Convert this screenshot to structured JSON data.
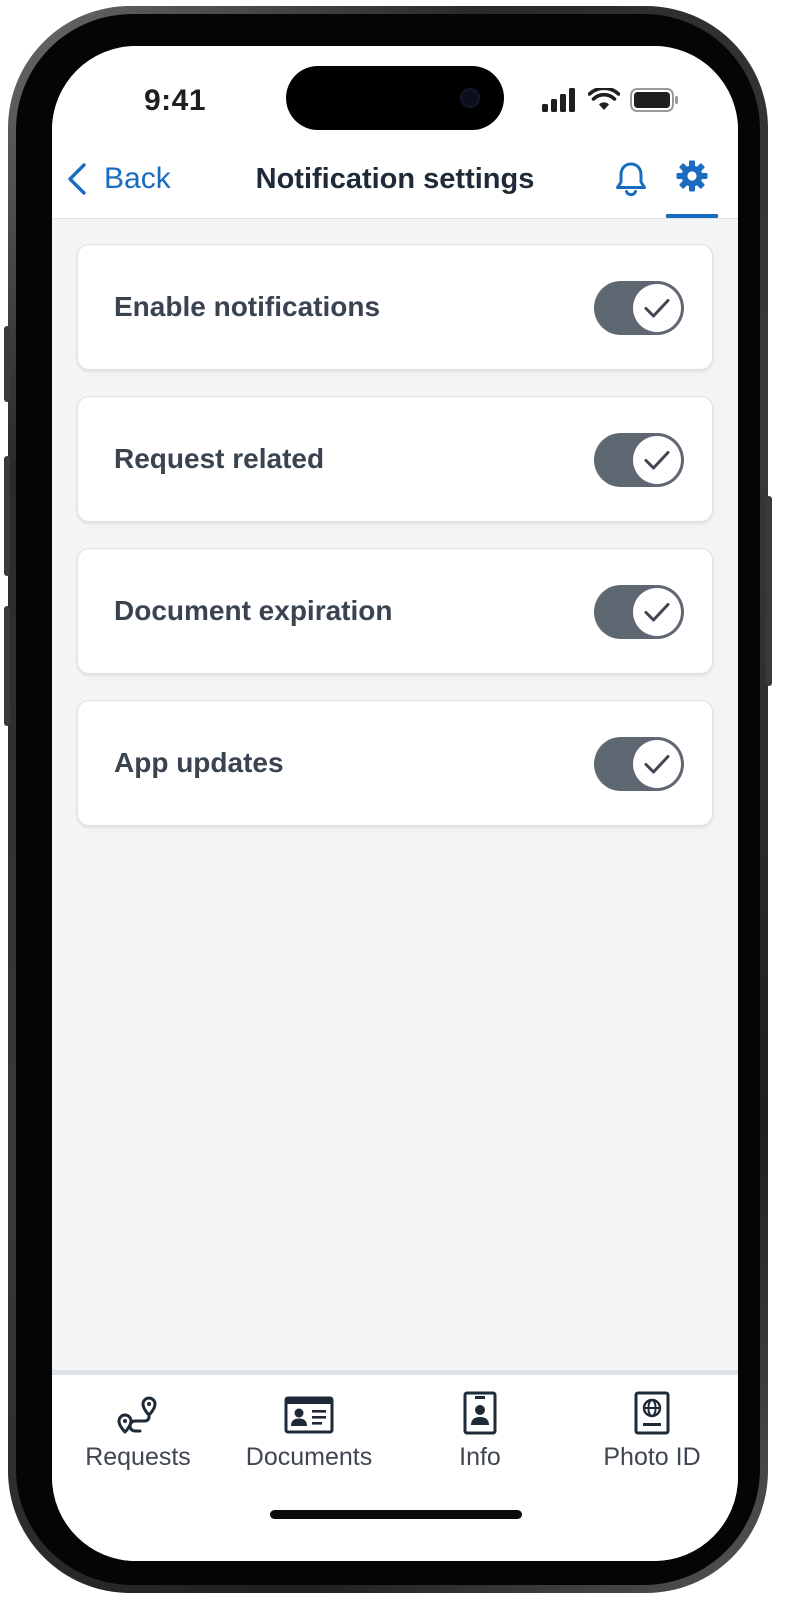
{
  "status_bar": {
    "time": "9:41"
  },
  "header": {
    "back_label": "Back",
    "title": "Notification settings",
    "active_tab_color": "#1a6cc0"
  },
  "settings": [
    {
      "label": "Enable notifications",
      "enabled": true
    },
    {
      "label": "Request related",
      "enabled": true
    },
    {
      "label": "Document expiration",
      "enabled": true
    },
    {
      "label": "App updates",
      "enabled": true
    }
  ],
  "tab_bar": {
    "tabs": [
      {
        "label": "Requests",
        "icon": "route-icon"
      },
      {
        "label": "Documents",
        "icon": "id-card-icon"
      },
      {
        "label": "Info",
        "icon": "badge-icon"
      },
      {
        "label": "Photo ID",
        "icon": "passport-icon"
      }
    ]
  },
  "colors": {
    "accent": "#1a6cc0",
    "toggle_on": "#5f6773",
    "background": "#f3f4f6"
  }
}
